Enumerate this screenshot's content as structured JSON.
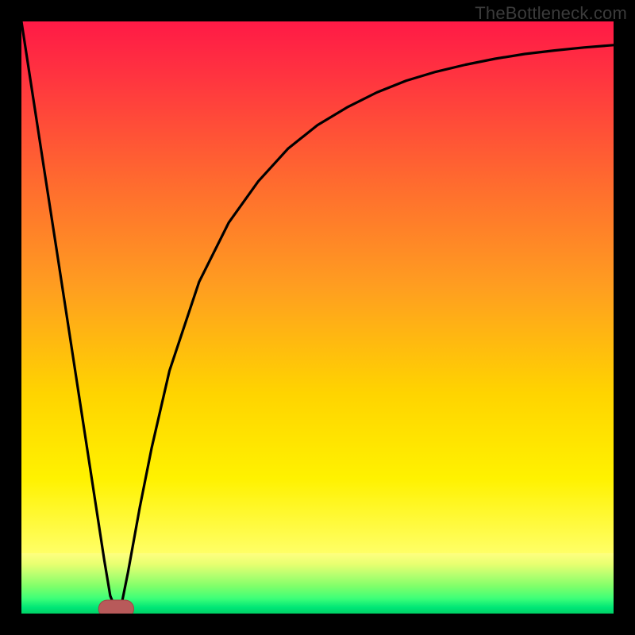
{
  "watermark": "TheBottleneck.com",
  "colors": {
    "frame": "#000000",
    "gradient_top": [
      "#ff1a46",
      "#ff3340",
      "#ff6a2f",
      "#ff9e20",
      "#ffd400",
      "#fff200",
      "#ffff66"
    ],
    "gradient_bottom": [
      "#ffff80",
      "#e8ff70",
      "#b8ff70",
      "#7fff6a",
      "#3dff78",
      "#00e676",
      "#00d166"
    ],
    "curve": "#000000",
    "marker_fill": "#b85a5a",
    "marker_stroke": "#a04545"
  },
  "chart_data": {
    "type": "line",
    "title": "",
    "xlabel": "",
    "ylabel": "",
    "xlim": [
      0,
      100
    ],
    "ylim": [
      0,
      100
    ],
    "x": [
      0,
      2,
      4,
      6,
      8,
      10,
      12,
      14,
      15,
      16,
      17,
      18,
      20,
      22,
      25,
      30,
      35,
      40,
      45,
      50,
      55,
      60,
      65,
      70,
      75,
      80,
      85,
      90,
      95,
      100
    ],
    "y": [
      100,
      87,
      74,
      61,
      48,
      35,
      22,
      9,
      3,
      0.5,
      2,
      7,
      18,
      28,
      41,
      56,
      66,
      73,
      78.5,
      82.5,
      85.5,
      88,
      90,
      91.5,
      92.7,
      93.7,
      94.5,
      95.1,
      95.6,
      96
    ],
    "marker": {
      "x_range": [
        14.5,
        17.5
      ],
      "y": 0.8
    },
    "grid": false,
    "legend": false,
    "notes": "V-shaped bottleneck curve with minimum near x≈16 and asymptotic rise to the right over a thermal red→yellow→green vertical gradient."
  }
}
